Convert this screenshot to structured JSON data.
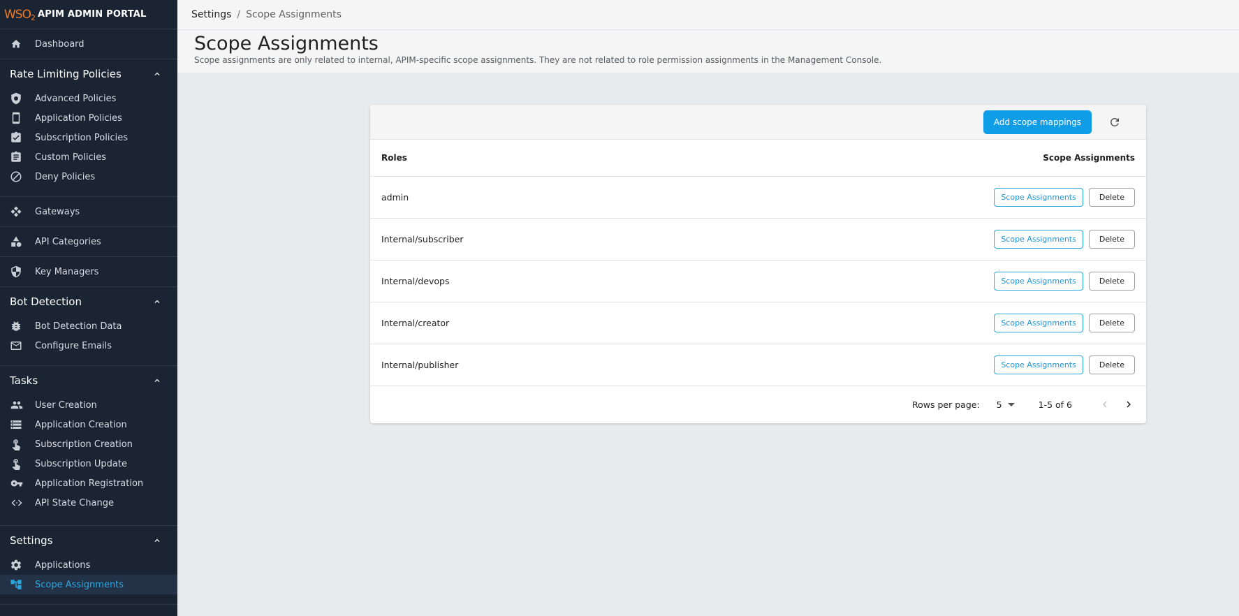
{
  "brand": {
    "logo_text": "WSO",
    "logo_sub": "2",
    "title": "APIM ADMIN PORTAL"
  },
  "sidebar": {
    "dashboard": {
      "label": "Dashboard",
      "icon": "home-icon"
    },
    "rate_limiting": {
      "title": "Rate Limiting Policies",
      "items": [
        {
          "label": "Advanced Policies",
          "icon": "shield-gear-icon"
        },
        {
          "label": "Application Policies",
          "icon": "app-policy-icon"
        },
        {
          "label": "Subscription Policies",
          "icon": "clipboard-check-icon"
        },
        {
          "label": "Custom Policies",
          "icon": "clipboard-list-icon"
        },
        {
          "label": "Deny Policies",
          "icon": "block-icon"
        }
      ]
    },
    "gateways": {
      "label": "Gateways",
      "icon": "gateway-icon"
    },
    "api_categories": {
      "label": "API Categories",
      "icon": "category-icon"
    },
    "key_managers": {
      "label": "Key Managers",
      "icon": "key-shield-icon"
    },
    "bot_detection": {
      "title": "Bot Detection",
      "items": [
        {
          "label": "Bot Detection Data",
          "icon": "bug-icon"
        },
        {
          "label": "Configure Emails",
          "icon": "mail-icon"
        }
      ]
    },
    "tasks": {
      "title": "Tasks",
      "items": [
        {
          "label": "User Creation",
          "icon": "people-icon"
        },
        {
          "label": "Application Creation",
          "icon": "storage-icon"
        },
        {
          "label": "Subscription Creation",
          "icon": "touch-icon"
        },
        {
          "label": "Subscription Update",
          "icon": "touch-icon"
        },
        {
          "label": "Application Registration",
          "icon": "key-icon"
        },
        {
          "label": "API State Change",
          "icon": "code-icon"
        }
      ]
    },
    "settings": {
      "title": "Settings",
      "items": [
        {
          "label": "Applications",
          "icon": "gear-icon"
        },
        {
          "label": "Scope Assignments",
          "icon": "account-tree-icon",
          "active": true
        }
      ]
    }
  },
  "breadcrumb": {
    "parent": "Settings",
    "separator": "/",
    "current": "Scope Assignments"
  },
  "page": {
    "title": "Scope Assignments",
    "description": "Scope assignments are only related to internal, APIM-specific scope assignments. They are not related to role permission assignments in the Management Console."
  },
  "toolbar": {
    "add_label": "Add scope mappings",
    "refresh_icon": "refresh-icon"
  },
  "table": {
    "columns": [
      "Roles",
      "Scope Assignments"
    ],
    "rows": [
      {
        "role": "admin",
        "scope_label": "Scope Assignments",
        "delete_label": "Delete"
      },
      {
        "role": "Internal/subscriber",
        "scope_label": "Scope Assignments",
        "delete_label": "Delete"
      },
      {
        "role": "Internal/devops",
        "scope_label": "Scope Assignments",
        "delete_label": "Delete"
      },
      {
        "role": "Internal/creator",
        "scope_label": "Scope Assignments",
        "delete_label": "Delete"
      },
      {
        "role": "Internal/publisher",
        "scope_label": "Scope Assignments",
        "delete_label": "Delete"
      }
    ]
  },
  "pagination": {
    "rows_per_page_label": "Rows per page:",
    "rows_per_page": "5",
    "range": "1-5 of 6"
  },
  "colors": {
    "sidebar_bg": "#1a2433",
    "accent": "#29a8e0",
    "primary_button": "#0f9de8",
    "brand_orange": "#f47b20"
  }
}
